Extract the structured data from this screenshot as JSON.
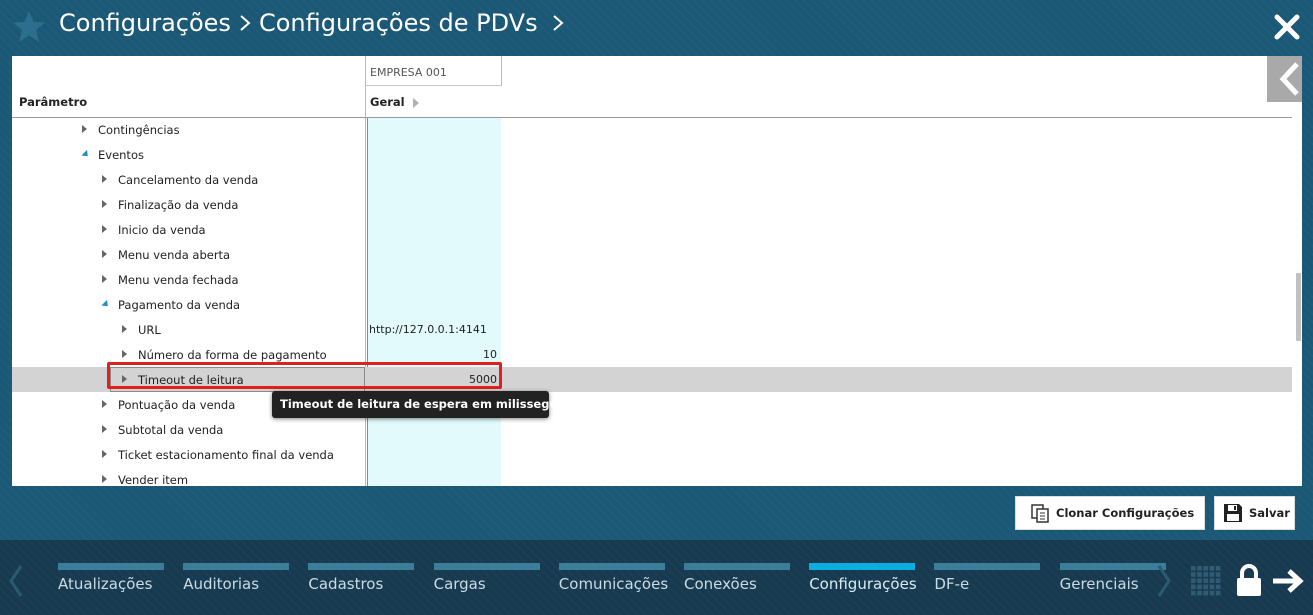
{
  "header": {
    "breadcrumb_1": "Configurações",
    "breadcrumb_2": "Configurações de PDVs"
  },
  "table": {
    "company_column": "EMPRESA 001",
    "param_header": "Parâmetro",
    "geral_header": "Geral",
    "rows": [
      {
        "label": "Contingências",
        "value": "",
        "expanded": false
      },
      {
        "label": "Eventos",
        "value": "",
        "expanded": true
      },
      {
        "label": "Cancelamento da venda",
        "value": "",
        "expanded": false
      },
      {
        "label": "Finalização da venda",
        "value": "",
        "expanded": false
      },
      {
        "label": "Inicio da venda",
        "value": "",
        "expanded": false
      },
      {
        "label": "Menu venda aberta",
        "value": "",
        "expanded": false
      },
      {
        "label": "Menu venda fechada",
        "value": "",
        "expanded": false
      },
      {
        "label": "Pagamento da venda",
        "value": "",
        "expanded": true
      },
      {
        "label": "URL",
        "value": "http://127.0.0.1:4141",
        "expanded": false
      },
      {
        "label": "Número da forma de pagamento",
        "value": "10",
        "expanded": false
      },
      {
        "label": "Timeout de leitura",
        "value": "5000",
        "expanded": false,
        "selected": true
      },
      {
        "label": "Pontuação da venda",
        "value": "",
        "expanded": false
      },
      {
        "label": "Subtotal da venda",
        "value": "",
        "expanded": false
      },
      {
        "label": "Ticket estacionamento final da venda",
        "value": "",
        "expanded": false
      },
      {
        "label": "Vender item",
        "value": "",
        "expanded": false
      }
    ],
    "tooltip": "Timeout de leitura de espera em milissegundos"
  },
  "actions": {
    "clone_label": "Clonar Configurações",
    "save_label": "Salvar"
  },
  "nav": {
    "tabs": [
      {
        "label": "Atualizações",
        "active": false
      },
      {
        "label": "Auditorias",
        "active": false
      },
      {
        "label": "Cadastros",
        "active": false
      },
      {
        "label": "Cargas",
        "active": false
      },
      {
        "label": "Comunicações",
        "active": false
      },
      {
        "label": "Conexões",
        "active": false
      },
      {
        "label": "Configurações",
        "active": true
      },
      {
        "label": "DF-e",
        "active": false
      },
      {
        "label": "Gerenciais",
        "active": false
      }
    ]
  },
  "colors": {
    "background": "#1a5876",
    "nav_background": "#173a50",
    "tab_bar": "#3a7e9a",
    "tab_bar_active": "#0aaee0",
    "geral_column": "#e2fafb",
    "selected_row": "#d3d3d3",
    "highlight": "#e0201c"
  }
}
